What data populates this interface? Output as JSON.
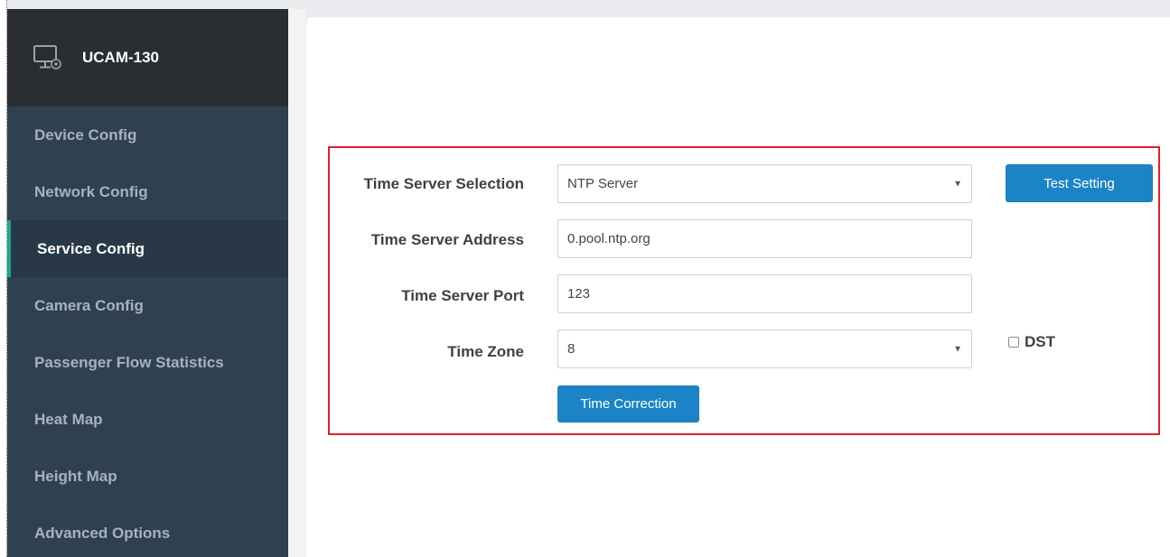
{
  "app": {
    "title": "UCAM-130",
    "logo_icon": "monitor-gear-icon"
  },
  "sidebar": {
    "items": [
      {
        "label": "Device Config",
        "active": false
      },
      {
        "label": "Network Config",
        "active": false
      },
      {
        "label": "Service Config",
        "active": true
      },
      {
        "label": "Camera Config",
        "active": false
      },
      {
        "label": "Passenger Flow Statistics",
        "active": false
      },
      {
        "label": "Heat Map",
        "active": false
      },
      {
        "label": "Height Map",
        "active": false
      },
      {
        "label": "Advanced Options",
        "active": false
      }
    ]
  },
  "form": {
    "time_server_selection": {
      "label": "Time Server Selection",
      "value": "NTP Server"
    },
    "time_server_address": {
      "label": "Time Server Address",
      "value": "0.pool.ntp.org"
    },
    "time_server_port": {
      "label": "Time Server Port",
      "value": "123"
    },
    "time_zone": {
      "label": "Time Zone",
      "value": "8"
    },
    "dst": {
      "label": "DST",
      "checked": false
    },
    "test_setting_label": "Test Setting",
    "time_correction_label": "Time Correction"
  },
  "colors": {
    "sidebar_bg": "#2f4050",
    "header_bg": "#2a2e33",
    "active_accent": "#19aa8d",
    "button": "#1c84c6",
    "highlight_border": "#e0202a"
  }
}
